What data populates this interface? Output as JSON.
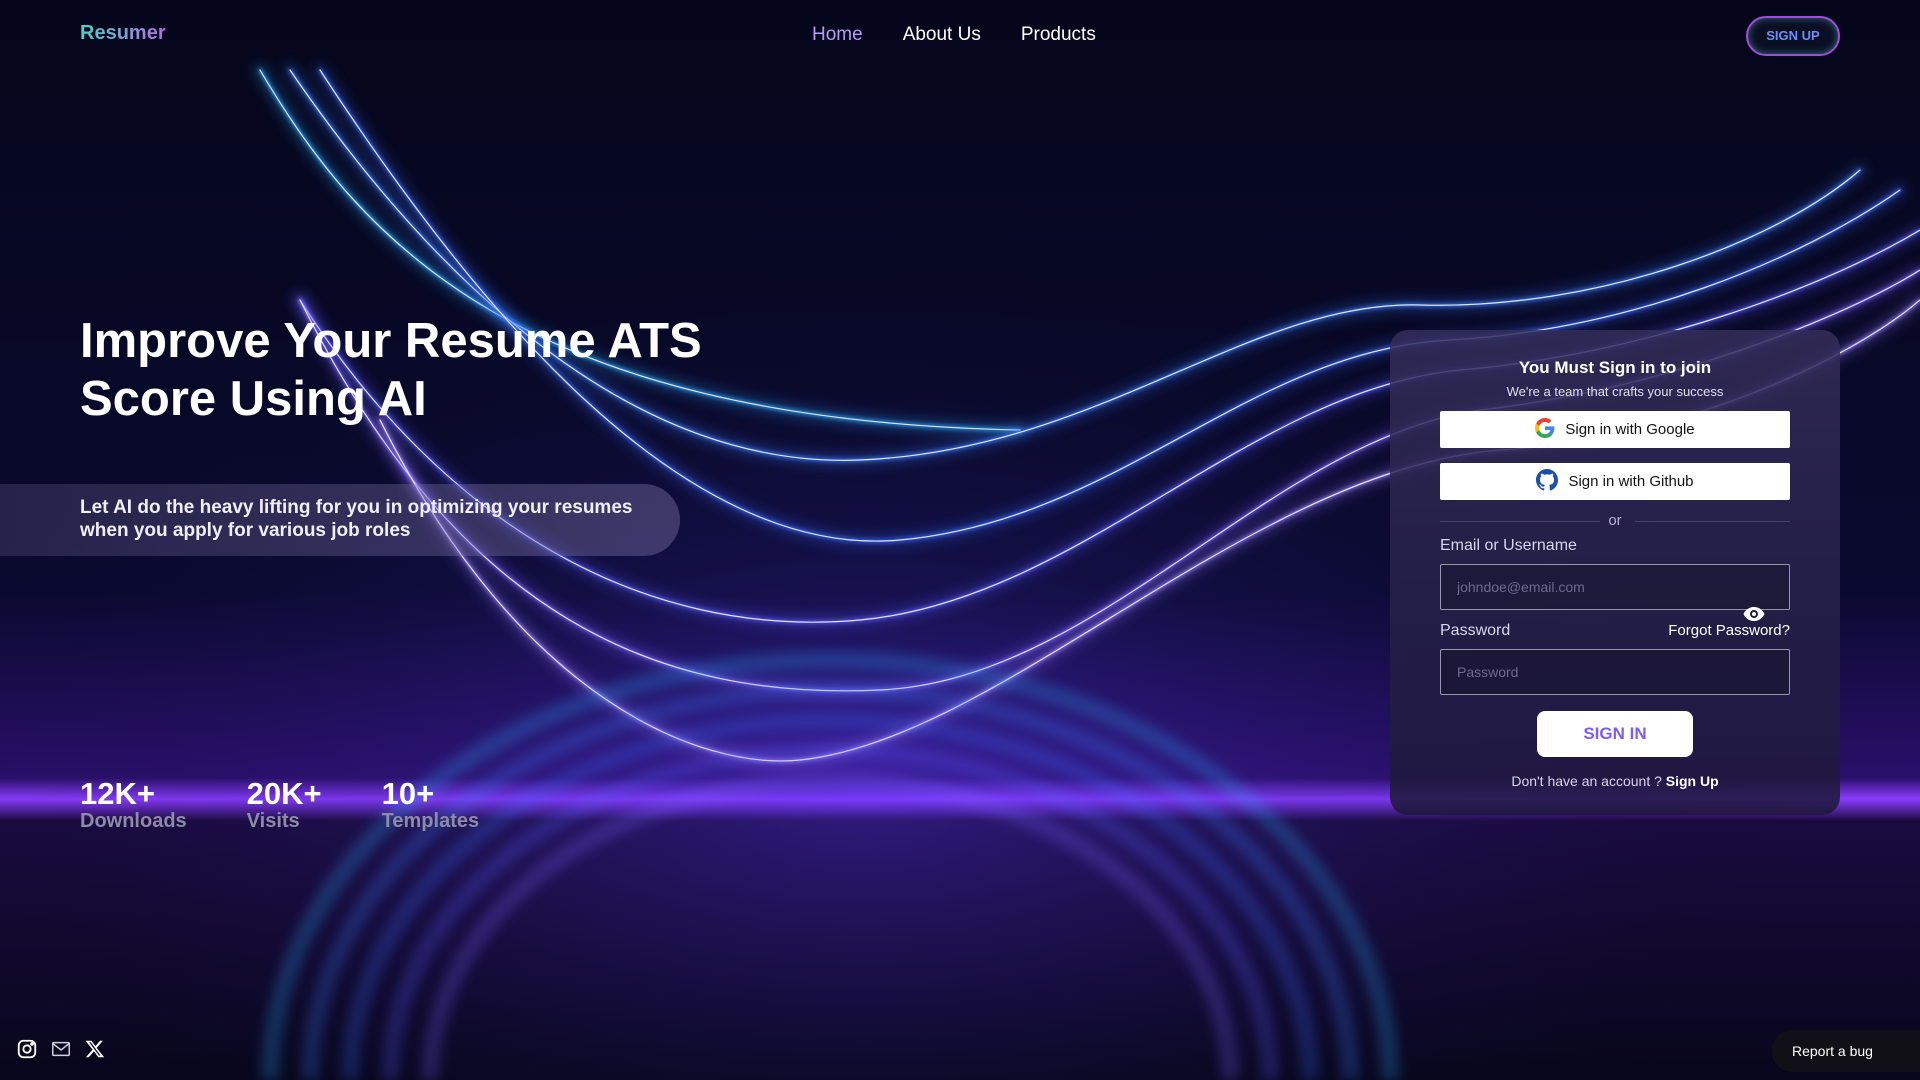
{
  "brand": {
    "logo_text": "Resumer"
  },
  "nav": {
    "links": [
      {
        "label": "Home",
        "active": true
      },
      {
        "label": "About Us",
        "active": false
      },
      {
        "label": "Products",
        "active": false
      }
    ],
    "signup_label": "SIGN UP"
  },
  "hero": {
    "title": "Improve Your Resume ATS Score Using AI",
    "subtitle": "Let AI do the heavy lifting for you in optimizing your resumes when you apply for various job roles"
  },
  "stats": [
    {
      "value": "12K+",
      "label": "Downloads"
    },
    {
      "value": "20K+",
      "label": "Visits"
    },
    {
      "value": "10+",
      "label": "Templates"
    }
  ],
  "signin_card": {
    "title": "You Must Sign in to join",
    "subtitle": "We're a team that crafts your success",
    "google_label": "Sign in with Google",
    "github_label": "Sign in with Github",
    "or_text": "or",
    "email_label": "Email or Username",
    "email_placeholder": "johndoe@email.com",
    "password_label": "Password",
    "forgot_label": "Forgot Password?",
    "password_placeholder": "Password",
    "signin_label": "SIGN IN",
    "no_account_text": "Don't have an account ?",
    "signup_link": "Sign Up"
  },
  "footer": {
    "socials": [
      "instagram-icon",
      "mail-icon",
      "x-icon"
    ],
    "report_bug_label": "Report a bug"
  },
  "colors": {
    "accent": "#b69cf5",
    "neon_blue": "#3b7dff",
    "neon_purple": "#b04cff",
    "background": "#05061a"
  }
}
